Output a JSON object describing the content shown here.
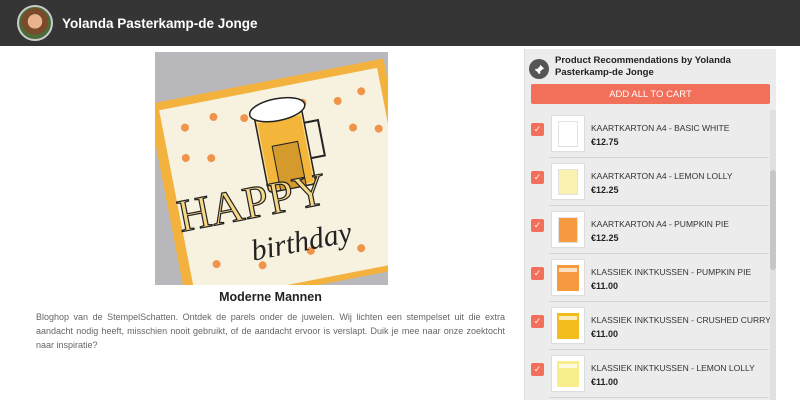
{
  "header": {
    "title": "Yolanda Pasterkamp-de Jonge"
  },
  "post": {
    "title": "Moderne Mannen",
    "text": "Bloghop van de StempelSchatten. Ontdek de parels onder de juwelen. Wij lichten een stempelset uit die extra aandacht nodig heeft, misschien nooit gebruikt, of de aandacht ervoor is verslapt. Duik je mee naar onze zoektocht naar inspiratie?",
    "image": {
      "word_top": "HAPPY",
      "word_bottom": "birthday"
    }
  },
  "panel": {
    "title": "Product Recommendations by Yolanda Pasterkamp-de Jonge",
    "add_all_label": "ADD ALL TO CART",
    "check_mark": "✓",
    "pin_icon": "pin-icon",
    "items": [
      {
        "name": "KAARTKARTON A4 - BASIC WHITE",
        "price": "€12.75",
        "color": "#ffffff",
        "kind": "cardstock"
      },
      {
        "name": "KAARTKARTON A4 - LEMON LOLLY",
        "price": "€12.25",
        "color": "#fbf1b0",
        "kind": "cardstock"
      },
      {
        "name": "KAARTKARTON A4 - PUMPKIN PIE",
        "price": "€12.25",
        "color": "#f59a3f",
        "kind": "cardstock"
      },
      {
        "name": "KLASSIEK INKTKUSSEN - PUMPKIN PIE",
        "price": "€11.00",
        "color": "#f59a3f",
        "kind": "inkpad"
      },
      {
        "name": "KLASSIEK INKTKUSSEN - CRUSHED CURRY",
        "price": "€11.00",
        "color": "#f3bd1c",
        "kind": "inkpad"
      },
      {
        "name": "KLASSIEK INKTKUSSEN - LEMON LOLLY",
        "price": "€11.00",
        "color": "#f9ee8c",
        "kind": "inkpad"
      }
    ]
  },
  "colors": {
    "topbar": "#353535",
    "accent": "#f26f5a"
  }
}
